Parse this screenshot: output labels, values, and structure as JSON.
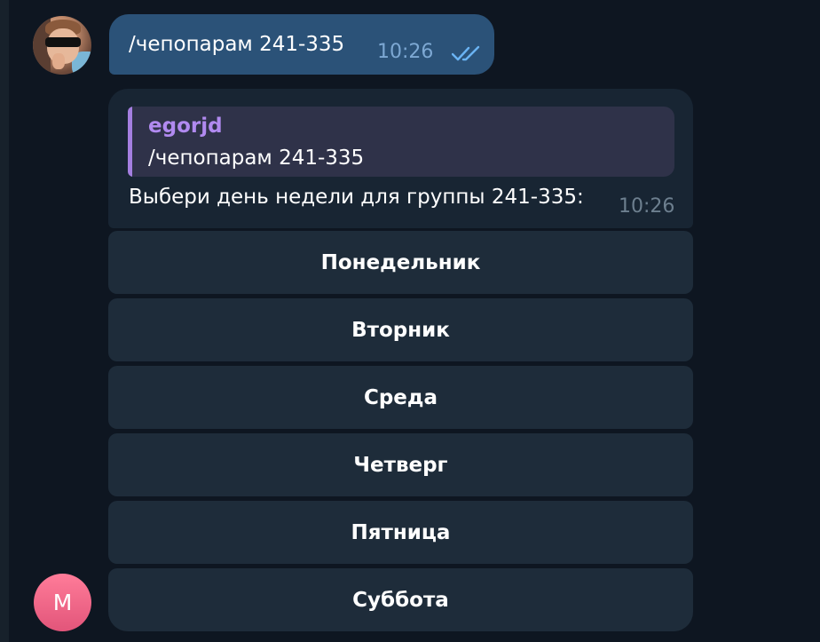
{
  "outgoing": {
    "text": "/чепопарам 241-335",
    "time": "10:26",
    "status_icon": "double-check-icon"
  },
  "incoming": {
    "reply": {
      "author": "egorjd",
      "text": "/чепопарам 241-335"
    },
    "text": "Выбери день недели для группы 241-335:",
    "time": "10:26"
  },
  "keyboard": {
    "buttons": [
      "Понедельник",
      "Вторник",
      "Среда",
      "Четверг",
      "Пятница",
      "Суббота"
    ]
  },
  "bot_avatar": {
    "initial": "M"
  },
  "colors": {
    "background": "#0e1621",
    "outgoing_bubble": "#2b5278",
    "incoming_bubble": "#182533",
    "button": "#1e2c3a",
    "reply_accent": "#a47fe0"
  }
}
